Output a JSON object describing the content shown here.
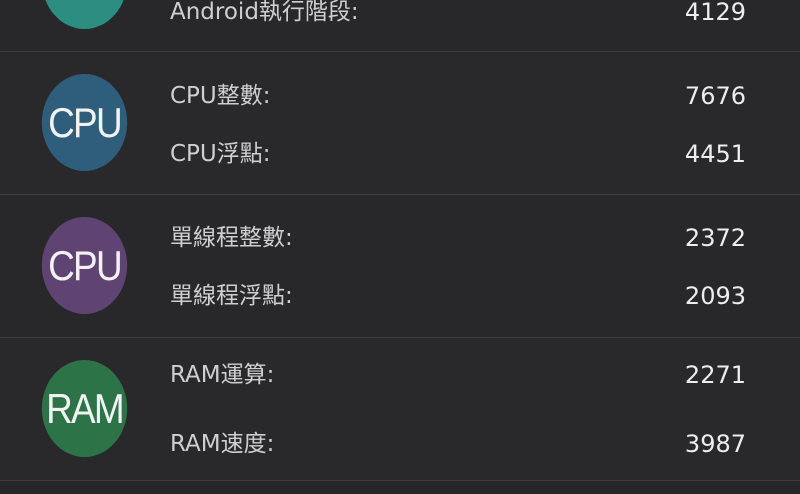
{
  "colors": {
    "background": "#262628",
    "divider": "#3d3d40",
    "label_text": "#cfcfd1",
    "value_text": "#ededee"
  },
  "groups": [
    {
      "badge": {
        "text": "",
        "color": "#2b8e80"
      },
      "rows": [
        {
          "label": "Android執行階段:",
          "value": "4129"
        }
      ]
    },
    {
      "badge": {
        "text": "CPU",
        "color": "#2f5e7c"
      },
      "rows": [
        {
          "label": "CPU整數:",
          "value": "7676"
        },
        {
          "label": "CPU浮點:",
          "value": "4451"
        }
      ]
    },
    {
      "badge": {
        "text": "CPU",
        "color": "#5f4473"
      },
      "rows": [
        {
          "label": "單線程整數:",
          "value": "2372"
        },
        {
          "label": "單線程浮點:",
          "value": "2093"
        }
      ]
    },
    {
      "badge": {
        "text": "RAM",
        "color": "#2c7448"
      },
      "rows": [
        {
          "label": "RAM運算:",
          "value": "2271"
        },
        {
          "label": "RAM速度:",
          "value": "3987"
        }
      ]
    }
  ]
}
